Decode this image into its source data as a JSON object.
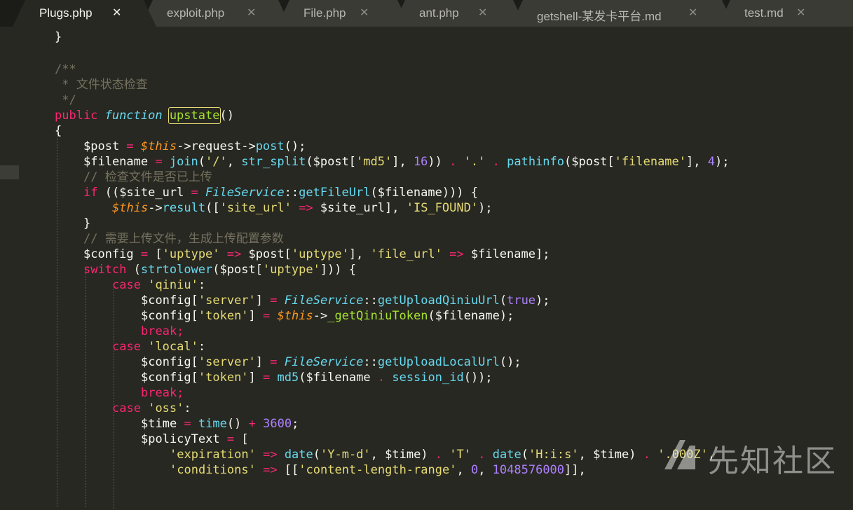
{
  "tabs": [
    {
      "label": "Plugs.php",
      "active": true
    },
    {
      "label": "exploit.php",
      "active": false
    },
    {
      "label": "File.php",
      "active": false
    },
    {
      "label": "ant.php",
      "active": false
    },
    {
      "label": "getshell-某发卡平台.md",
      "active": false
    },
    {
      "label": "test.md",
      "active": false
    }
  ],
  "close_glyph": "✕",
  "code": {
    "l0": "}",
    "l1": "/**",
    "l2": " * 文件状态检查",
    "l3": " */",
    "l4_kw": "public",
    "l4_fn_kw": "function",
    "l4_name": "upstate",
    "l4_paren": "()",
    "l5": "{",
    "l6": {
      "a": "$post",
      "b": " = ",
      "c": "$this",
      "d": "->request->",
      "e": "post",
      "f": "();"
    },
    "l7": {
      "a": "$filename",
      "b": " = ",
      "c": "join",
      "d": "(",
      "e": "'/'",
      "f": ", ",
      "g": "str_split",
      "h": "($post[",
      "i": "'md5'",
      "j": "], ",
      "k": "16",
      "l": ")) ",
      "m": ".",
      "n": " ",
      "o": "'.'",
      "p": " ",
      "q": ".",
      "r": " ",
      "s": "pathinfo",
      "t": "($post[",
      "u": "'filename'",
      "v": "], ",
      "w": "4",
      "x": ");"
    },
    "l8": "// 检查文件是否已上传",
    "l9": {
      "a": "if",
      "b": " (($site_url ",
      "c": "=",
      "d": " ",
      "e": "FileService",
      "f": "::",
      "g": "getFileUrl",
      "h": "($filename))) {"
    },
    "l10": {
      "a": "$this",
      "b": "->",
      "c": "result",
      "d": "([",
      "e": "'site_url'",
      "f": " ",
      "g": "=>",
      "h": " $site_url], ",
      "i": "'IS_FOUND'",
      "j": ");"
    },
    "l11": "}",
    "l12": "// 需要上传文件，生成上传配置参数",
    "l13": {
      "a": "$config",
      "b": " ",
      "c": "=",
      "d": " [",
      "e": "'uptype'",
      "f": " ",
      "g": "=>",
      "h": " $post[",
      "i": "'uptype'",
      "j": "], ",
      "k": "'file_url'",
      "l": " ",
      "m": "=>",
      "n": " $filename];"
    },
    "l14": {
      "a": "switch",
      "b": " (",
      "c": "strtolower",
      "d": "($post[",
      "e": "'uptype'",
      "f": "])) {"
    },
    "l15": {
      "a": "case",
      "b": " ",
      "c": "'qiniu'",
      "d": ":"
    },
    "l16": {
      "a": "$config[",
      "b": "'server'",
      "c": "] ",
      "d": "=",
      "e": " ",
      "f": "FileService",
      "g": "::",
      "h": "getUploadQiniuUrl",
      "i": "(",
      "j": "true",
      "k": ");"
    },
    "l17": {
      "a": "$config[",
      "b": "'token'",
      "c": "] ",
      "d": "=",
      "e": " ",
      "f": "$this",
      "g": "->",
      "h": "_getQiniuToken",
      "i": "($filename);"
    },
    "l18": "break;",
    "l19": {
      "a": "case",
      "b": " ",
      "c": "'local'",
      "d": ":"
    },
    "l20": {
      "a": "$config[",
      "b": "'server'",
      "c": "] ",
      "d": "=",
      "e": " ",
      "f": "FileService",
      "g": "::",
      "h": "getUploadLocalUrl",
      "i": "();"
    },
    "l21": {
      "a": "$config[",
      "b": "'token'",
      "c": "] ",
      "d": "=",
      "e": " ",
      "f": "md5",
      "g": "($filename ",
      "h": ".",
      "i": " ",
      "j": "session_id",
      "k": "());"
    },
    "l22": "break;",
    "l23": {
      "a": "case",
      "b": " ",
      "c": "'oss'",
      "d": ":"
    },
    "l24": {
      "a": "$time",
      "b": " ",
      "c": "=",
      "d": " ",
      "e": "time",
      "f": "() ",
      "g": "+",
      "h": " ",
      "i": "3600",
      "j": ";"
    },
    "l25": {
      "a": "$policyText",
      "b": " ",
      "c": "=",
      "d": " ["
    },
    "l26": {
      "a": "'expiration'",
      "b": " ",
      "c": "=>",
      "d": " ",
      "e": "date",
      "f": "(",
      "g": "'Y-m-d'",
      "h": ", $time) ",
      "i": ".",
      "j": " ",
      "k": "'T'",
      "l": " ",
      "m": ".",
      "n": " ",
      "o": "date",
      "p": "(",
      "q": "'H:i:s'",
      "r": ", $time) ",
      "s": ".",
      "t": " ",
      "u": "'.000Z'",
      "v": ","
    },
    "l27": {
      "a": "'conditions'",
      "b": " ",
      "c": "=>",
      "d": " [[",
      "e": "'content-length-range'",
      "f": ", ",
      "g": "0",
      "h": ", ",
      "i": "1048576000",
      "j": "]],"
    }
  },
  "watermark": {
    "text": "先知社区",
    "logo": "xianzhi-logo"
  },
  "colors": {
    "background": "#272822",
    "keyword": "#f92672",
    "function": "#a6e22e",
    "string": "#e6db74",
    "number": "#ae81ff",
    "comment": "#75715e",
    "this": "#fd971f",
    "storage": "#66d9ef"
  }
}
